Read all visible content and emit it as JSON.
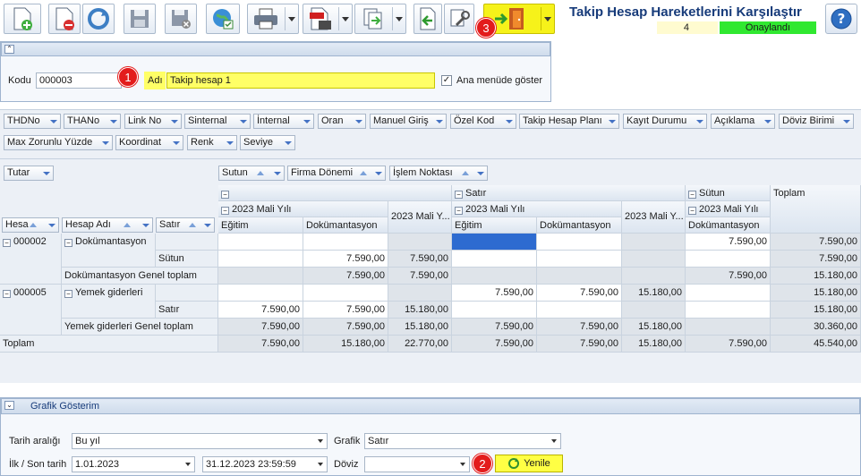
{
  "window": {
    "title": "Takip Hesap Hareketlerini Karşılaştır",
    "record_count": "4",
    "status": "Onaylandı",
    "colors": {
      "status": "#30e830",
      "highlight": "#ffff66",
      "badge": "#e31c1c",
      "selection": "#2d6bd0"
    }
  },
  "toolbar": {
    "buttons": [
      {
        "icon": "new-document-icon"
      },
      {
        "icon": "delete-document-icon"
      },
      {
        "icon": "refresh-icon"
      },
      {
        "icon": "save-icon"
      },
      {
        "icon": "save-close-icon"
      },
      {
        "icon": "web-publish-icon"
      },
      {
        "icon": "print-icon"
      },
      {
        "icon": "pdf-export-icon"
      },
      {
        "icon": "copy-document-icon"
      },
      {
        "icon": "back-arrow-icon"
      },
      {
        "icon": "tools-icon"
      },
      {
        "icon": "exit-door-icon"
      }
    ],
    "badges": {
      "b1": "1",
      "b2": "2",
      "b3": "3"
    }
  },
  "form": {
    "code_label": "Kodu",
    "code_value": "000003",
    "name_label": "Adı",
    "name_value": "Takip hesap 1",
    "menu_label": "Ana menüde göster",
    "menu_checked": true
  },
  "pivot": {
    "filter_fields": [
      "THDNo",
      "THANo",
      "Link No",
      "Sinternal",
      "İnternal",
      "Oran",
      "Manuel Giriş",
      "Özel Kod",
      "Takip Hesap Planı",
      "Kayıt Durumu",
      "Açıklama",
      "Döviz Birimi"
    ],
    "filter_fields_row2": [
      "Max Zorunlu Yüzde",
      "Koordinat",
      "Renk",
      "Seviye"
    ],
    "data_field": "Tutar",
    "column_fields": [
      "Sutun",
      "Firma Dönemi",
      "İşlem Noktası"
    ],
    "row_fields": [
      "Hesa",
      "Hesap Adı",
      "Satır"
    ],
    "col_headers": {
      "g1": "",
      "g2": "Satır",
      "g3": "Sütun",
      "total": "Toplam",
      "y1": "2023 Mali Yılı",
      "y1t": "2023 Mali Y...",
      "y2": "2023 Mali Yılı",
      "y2t": "2023 Mali Y...",
      "y3": "2023 Mali Yılı",
      "c1": "Eğitim",
      "c2": "Dokümantasyon",
      "c3": "Eğitim",
      "c4": "Dokümantasyon",
      "c5": "Dokümantasyon"
    },
    "rows": [
      {
        "code": "000002",
        "name": "Dokümantasyon",
        "sub": "",
        "vals": [
          "",
          "",
          "",
          "",
          "",
          "",
          "7.590,00",
          "7.590,00"
        ]
      },
      {
        "code": "",
        "name": "",
        "sub": "Sütun",
        "vals": [
          "",
          "7.590,00",
          "7.590,00",
          "",
          "",
          "",
          "",
          "7.590,00"
        ]
      },
      {
        "code": "",
        "name": "Dokümantasyon Genel toplam",
        "sub": "",
        "vals": [
          "",
          "7.590,00",
          "7.590,00",
          "",
          "",
          "",
          "7.590,00",
          "15.180,00"
        ]
      },
      {
        "code": "000005",
        "name": "Yemek giderleri",
        "sub": "",
        "vals": [
          "",
          "",
          "",
          "7.590,00",
          "7.590,00",
          "15.180,00",
          "",
          "15.180,00"
        ]
      },
      {
        "code": "",
        "name": "",
        "sub": "Satır",
        "vals": [
          "7.590,00",
          "7.590,00",
          "15.180,00",
          "",
          "",
          "",
          "",
          "15.180,00"
        ]
      },
      {
        "code": "",
        "name": "Yemek giderleri Genel toplam",
        "sub": "",
        "vals": [
          "7.590,00",
          "7.590,00",
          "15.180,00",
          "7.590,00",
          "7.590,00",
          "15.180,00",
          "",
          "30.360,00"
        ]
      },
      {
        "code": "",
        "name": "Toplam",
        "sub": "",
        "vals": [
          "7.590,00",
          "15.180,00",
          "22.770,00",
          "7.590,00",
          "7.590,00",
          "15.180,00",
          "7.590,00",
          "45.540,00"
        ]
      }
    ]
  },
  "graph": {
    "header": "Grafik Gösterim",
    "date_range_label": "Tarih aralığı",
    "date_range_value": "Bu yıl",
    "chart_label": "Grafik",
    "chart_value": "Satır",
    "first_last_label": "İlk / Son tarih",
    "first_date": "1.01.2023",
    "last_date": "31.12.2023 23:59:59",
    "currency_label": "Döviz",
    "currency_value": "",
    "refresh_label": "Yenile"
  }
}
